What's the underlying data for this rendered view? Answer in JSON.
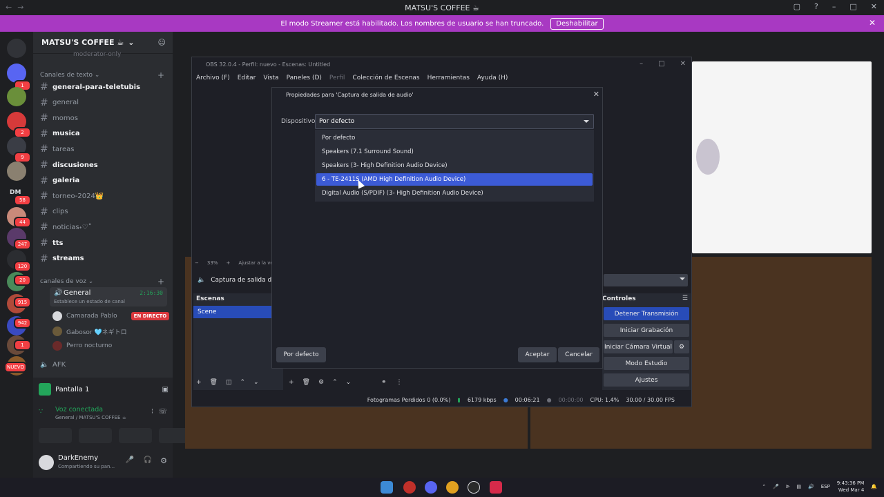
{
  "window": {
    "title": "MATSU'S COFFEE ☕"
  },
  "streamer_banner": {
    "message": "El modo Streamer está habilitado. Los nombres de usuario se han truncado.",
    "button": "Deshabilitar"
  },
  "server_rail": {
    "badges": [
      "1",
      "2",
      "9",
      "DM",
      "58",
      "44",
      "247",
      "120",
      "20",
      "915",
      "942",
      "1",
      "NUEVO"
    ]
  },
  "server": {
    "name": "MATSU'S COFFEE ☕",
    "truncated_channel": "moderator-only",
    "text_category": "Canales de texto",
    "text_channels": [
      {
        "name": "general-para-teletubis",
        "unread": true
      },
      {
        "name": "general",
        "unread": false
      },
      {
        "name": "momos",
        "unread": false
      },
      {
        "name": "musica",
        "unread": true
      },
      {
        "name": "tareas",
        "unread": false
      },
      {
        "name": "discusiones",
        "unread": true
      },
      {
        "name": "galeria",
        "unread": true
      },
      {
        "name": "torneo-2024👑",
        "unread": false
      },
      {
        "name": "clips",
        "unread": false
      },
      {
        "name": "noticias˖♡˚",
        "unread": false
      },
      {
        "name": "tts",
        "unread": true
      },
      {
        "name": "streams",
        "unread": true
      }
    ],
    "voice_category": "canales de voz",
    "voice_channel": {
      "name": "General",
      "time": "2:16:30",
      "status": "Establece un estado de canal"
    },
    "voice_users": [
      {
        "name": "Camarada Pablo",
        "live": "EN DIRECTO"
      },
      {
        "name": "Gabosor 🩵ネギトロ",
        "live": ""
      },
      {
        "name": "Perro nocturno",
        "live": ""
      }
    ],
    "afk_channel": "AFK"
  },
  "user_panel": {
    "screen_share": "Pantalla 1",
    "voice_status": "Voz conectada",
    "voice_location": "General / MATSU'S COFFEE ☕",
    "username": "DarkEnemy",
    "user_status": "Compartiendo su pan..."
  },
  "obs": {
    "title": "OBS 32.0.4 - Perfil: nuevo - Escenas: Untitled",
    "menu": [
      "Archivo (F)",
      "Editar",
      "Vista",
      "Paneles (D)",
      "Perfil",
      "Colección de Escenas",
      "Herramientas",
      "Ayuda (H)"
    ],
    "zoom": "33%",
    "fit_label": "Ajustar a la ve",
    "source_label": "Captura de salida de au",
    "scenes_header": "Escenas",
    "scene_item": "Scene",
    "controls_header": "Controles",
    "controls": [
      "Detener Transmisión",
      "Iniciar Grabación",
      "Iniciar Cámara Virtual",
      "Modo Estudio",
      "Ajustes"
    ],
    "status": {
      "dropped": "Fotogramas Perdidos 0 (0.0%)",
      "kbps": "6179 kbps",
      "stream_time": "00:06:21",
      "rec_time": "00:00:00",
      "cpu": "CPU: 1.4%",
      "fps": "30.00 / 30.00 FPS"
    }
  },
  "dialog": {
    "title": "Propiedades para 'Captura de salida de audio'",
    "device_label": "Dispositivo",
    "device_value": "Por defecto",
    "options": [
      "Por defecto",
      "Speakers (7.1 Surround Sound)",
      "Speakers (3- High Definition Audio Device)",
      "6 - TE-2411S (AMD High Definition Audio Device)",
      "Digital Audio (S/PDIF) (3- High Definition Audio Device)"
    ],
    "selected_index": 3,
    "defaults_button": "Por defecto",
    "ok_button": "Aceptar",
    "cancel_button": "Cancelar"
  },
  "taskbar": {
    "lang": "ESP",
    "time": "9:43:36 PM",
    "date": "Wed Mar 4"
  },
  "colors": {
    "streamer_banner": "#a839c2",
    "selection": "#3c5bd6",
    "obs_primary": "#284cb8"
  }
}
